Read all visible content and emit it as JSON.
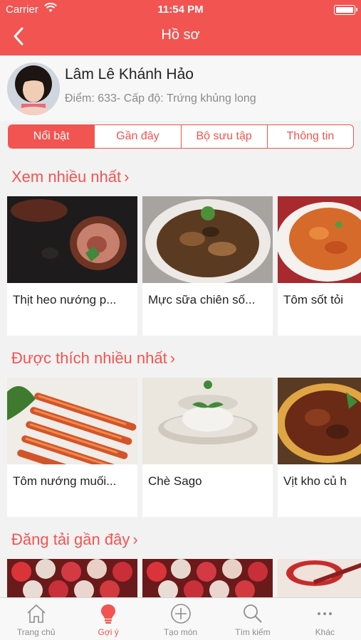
{
  "status_bar": {
    "carrier": "Carrier",
    "time": "11:54 PM"
  },
  "nav": {
    "title": "Hồ sơ"
  },
  "profile": {
    "name": "Lâm Lê Khánh Hảo",
    "info": "Điểm: 633- Cấp độ: Trứng khủng long"
  },
  "segments": [
    {
      "label": "Nổi bật",
      "active": true
    },
    {
      "label": "Gần đây",
      "active": false
    },
    {
      "label": "Bộ sưu tập",
      "active": false
    },
    {
      "label": "Thông tin",
      "active": false
    }
  ],
  "sections": [
    {
      "title": "Xem nhiều nhất",
      "items": [
        "Thịt heo nướng p...",
        "Mực sữa chiên số...",
        "Tôm sốt tỏi"
      ]
    },
    {
      "title": "Được thích nhiều nhất",
      "items": [
        "Tôm nướng muối...",
        "Chè Sago",
        "Vịt kho củ h"
      ]
    },
    {
      "title": "Đăng tải gần đây",
      "items": []
    }
  ],
  "tabs": [
    {
      "label": "Trang chủ",
      "icon": "home-icon",
      "active": false
    },
    {
      "label": "Gợi ý",
      "icon": "lightbulb-icon",
      "active": true
    },
    {
      "label": "Tạo món",
      "icon": "add-circle-icon",
      "active": false
    },
    {
      "label": "Tìm kiếm",
      "icon": "search-icon",
      "active": false
    },
    {
      "label": "Khác",
      "icon": "more-icon",
      "active": false
    }
  ],
  "colors": {
    "accent": "#f25451",
    "background": "#f2f2f2"
  }
}
